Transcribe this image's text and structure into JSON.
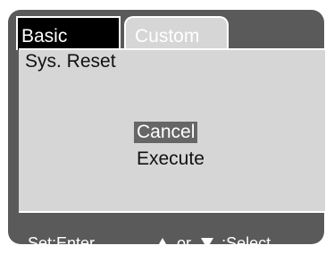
{
  "tabs": [
    {
      "label": "Basic",
      "active": true
    },
    {
      "label": "Custom",
      "active": false
    }
  ],
  "panel": {
    "title": "Sys. Reset",
    "options": [
      {
        "label": "Cancel",
        "selected": true
      },
      {
        "label": "Execute",
        "selected": false
      }
    ]
  },
  "footer": {
    "left": "Set:Enter",
    "right_middle": "or",
    "right_end": ":Select"
  },
  "icons": {
    "up": "up-triangle-icon",
    "down": "down-triangle-icon"
  },
  "colors": {
    "frame": "#5a5a5a",
    "panel": "#d6d6d6",
    "selection": "#666666",
    "tab_active": "#000000",
    "text_light": "#ffffff"
  }
}
